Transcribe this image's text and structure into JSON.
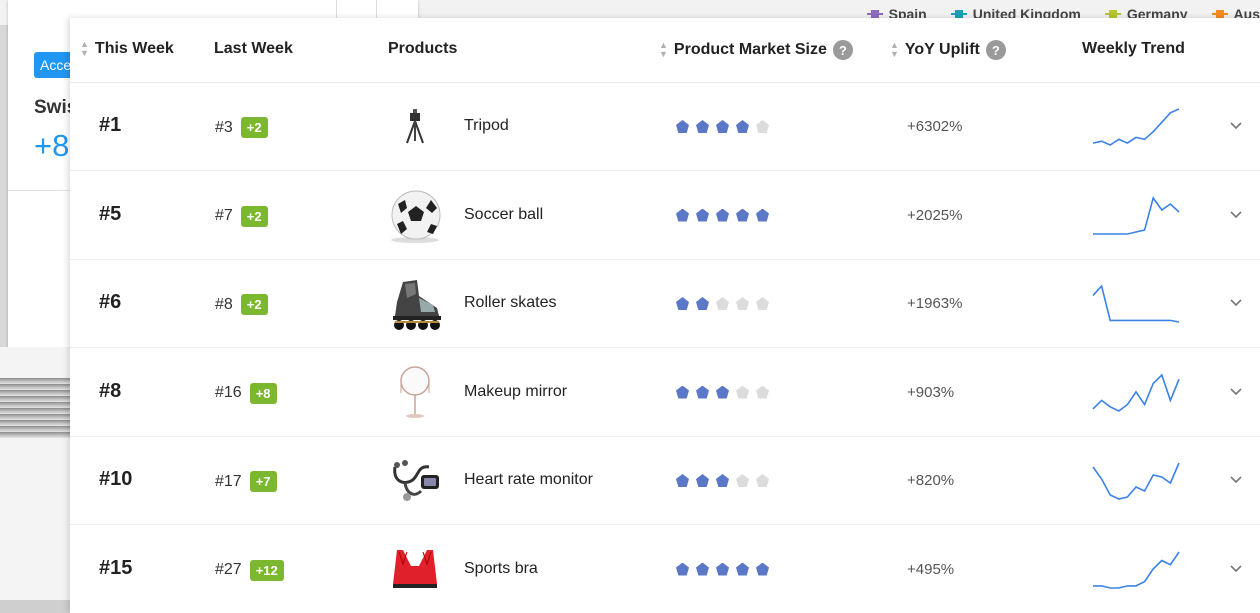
{
  "legend": [
    {
      "label": "Spain",
      "color": "#8e6bbf"
    },
    {
      "label": "United Kingdom",
      "color": "#17a2b8"
    },
    {
      "label": "Germany",
      "color": "#b5c334"
    },
    {
      "label": "Aus",
      "color": "#f58a1f"
    }
  ],
  "background_card": {
    "tag": "Acce",
    "name": "Swis",
    "value": "+8"
  },
  "table": {
    "headers": {
      "this_week": "This Week",
      "last_week": "Last Week",
      "products": "Products",
      "market_size": "Product Market Size",
      "market_size_help": "?",
      "yoy": "YoY Uplift",
      "yoy_help": "?",
      "trend": "Weekly Trend"
    },
    "rows": [
      {
        "rank": "#1",
        "last_week": "#3",
        "change": "+2",
        "product": "Tripod",
        "product_icon": "tripod-icon",
        "stars": 4,
        "uplift": "+6302%",
        "trend": [
          6,
          7,
          5,
          8,
          6,
          9,
          8,
          12,
          17,
          22,
          24
        ]
      },
      {
        "rank": "#5",
        "last_week": "#7",
        "change": "+2",
        "product": "Soccer ball",
        "product_icon": "soccer-ball-icon",
        "stars": 5,
        "uplift": "+2025%",
        "trend": [
          4,
          4,
          4,
          4,
          4,
          5,
          6,
          22,
          16,
          19,
          15
        ]
      },
      {
        "rank": "#6",
        "last_week": "#8",
        "change": "+2",
        "product": "Roller skates",
        "product_icon": "roller-skate-icon",
        "stars": 2,
        "uplift": "+1963%",
        "trend": [
          20,
          26,
          4,
          4,
          4,
          4,
          4,
          4,
          4,
          4,
          3
        ]
      },
      {
        "rank": "#8",
        "last_week": "#16",
        "change": "+8",
        "product": "Makeup mirror",
        "product_icon": "mirror-icon",
        "stars": 3,
        "uplift": "+903%",
        "trend": [
          8,
          12,
          9,
          7,
          10,
          16,
          10,
          20,
          24,
          12,
          22
        ]
      },
      {
        "rank": "#10",
        "last_week": "#17",
        "change": "+7",
        "product": "Heart rate monitor",
        "product_icon": "stethoscope-icon",
        "stars": 3,
        "uplift": "+820%",
        "trend": [
          22,
          16,
          8,
          6,
          7,
          12,
          10,
          18,
          17,
          14,
          24
        ]
      },
      {
        "rank": "#15",
        "last_week": "#27",
        "change": "+12",
        "product": "Sports bra",
        "product_icon": "sports-bra-icon",
        "stars": 5,
        "uplift": "+495%",
        "trend": [
          4,
          4,
          3,
          3,
          4,
          4,
          6,
          12,
          16,
          14,
          20
        ]
      }
    ]
  },
  "colors": {
    "accent": "#2196f3",
    "badge": "#7cb82f",
    "star_on": "#5b78c8",
    "star_off": "#dcdcdc",
    "trend_line": "#3b82e6"
  }
}
